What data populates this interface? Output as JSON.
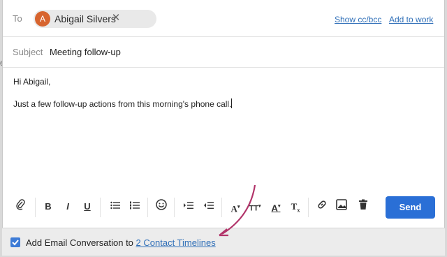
{
  "to": {
    "label": "To",
    "recipient": {
      "initial": "A",
      "name": "Abigail Silvers"
    },
    "remove_icon": "✕",
    "show_cc_bcc": "Show cc/bcc",
    "add_to_work": "Add to work"
  },
  "subject": {
    "label": "Subject",
    "value": "Meeting follow-up"
  },
  "body": {
    "line1": "Hi Abigail,",
    "line2": "Just a few follow-up actions from this morning's phone call."
  },
  "toolbar": {
    "bold": "B",
    "italic": "I",
    "underline": "U",
    "send_label": "Send",
    "icons": [
      "paperclip-icon",
      "bold-icon",
      "italic-icon",
      "underline-icon",
      "bulleted-list-icon",
      "numbered-list-icon",
      "emoji-icon",
      "indent-icon",
      "outdent-icon",
      "font-icon",
      "font-size-icon",
      "font-color-icon",
      "clear-format-icon",
      "link-icon",
      "image-icon",
      "trash-icon"
    ]
  },
  "footer": {
    "checkbox_checked": true,
    "text": "Add Email Conversation to ",
    "link": "2 Contact Timelines"
  },
  "colors": {
    "accent": "#2a6fd6",
    "avatar": "#d7642e",
    "arrow": "#b2346a"
  },
  "edge_digit": "6"
}
